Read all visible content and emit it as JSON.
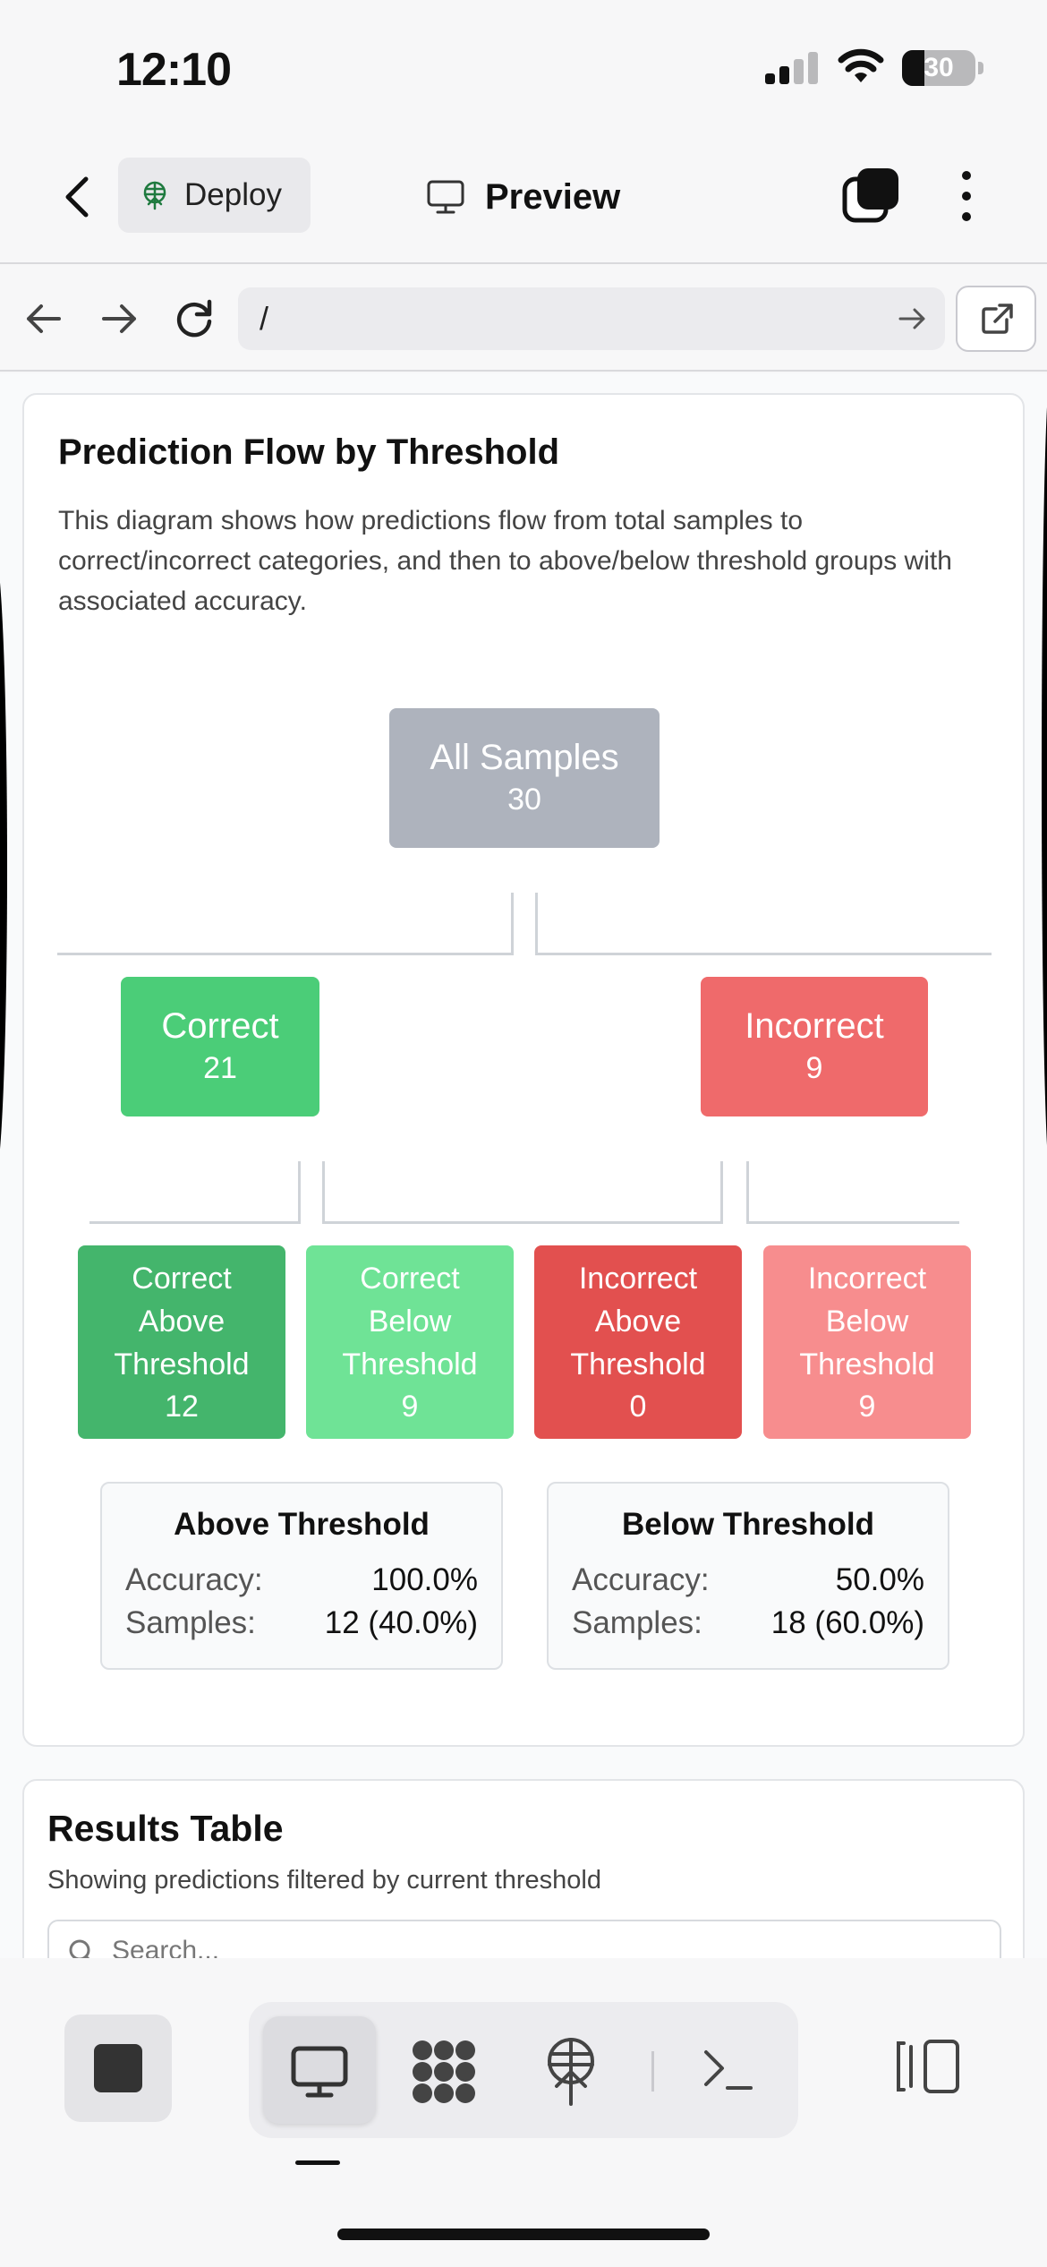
{
  "status_bar": {
    "time": "12:10",
    "battery": "30",
    "battery_level": 0.3
  },
  "header": {
    "deploy_label": "Deploy",
    "preview_label": "Preview"
  },
  "url_bar": {
    "url": "/"
  },
  "diagram_card": {
    "title": "Prediction Flow by Threshold",
    "description": "This diagram shows how predictions flow from total samples to correct/incorrect categories, and then to above/below threshold groups with associated accuracy.",
    "nodes": {
      "all": {
        "label": "All Samples",
        "count": "30",
        "color": "#aeb3bd"
      },
      "correct": {
        "label": "Correct",
        "count": "21",
        "color": "#4bcd78"
      },
      "incorrect": {
        "label": "Incorrect",
        "count": "9",
        "color": "#ef6a6b"
      },
      "correct_above": {
        "label": [
          "Correct",
          "Above",
          "Threshold"
        ],
        "count": "12",
        "color": "#44b56c"
      },
      "correct_below": {
        "label": [
          "Correct",
          "Below",
          "Threshold"
        ],
        "count": "9",
        "color": "#6fe396"
      },
      "incorrect_above": {
        "label": [
          "Incorrect",
          "Above",
          "Threshold"
        ],
        "count": "0",
        "color": "#e2504f"
      },
      "incorrect_below": {
        "label": [
          "Incorrect",
          "Below",
          "Threshold"
        ],
        "count": "9",
        "color": "#f78d8e"
      }
    },
    "stats": [
      {
        "title": "Above Threshold",
        "accuracy_label": "Accuracy:",
        "accuracy": "100.0%",
        "samples_label": "Samples:",
        "samples": "12 (40.0%)"
      },
      {
        "title": "Below Threshold",
        "accuracy_label": "Accuracy:",
        "accuracy": "50.0%",
        "samples_label": "Samples:",
        "samples": "18 (60.0%)"
      }
    ]
  },
  "results_card": {
    "title": "Results Table",
    "subtitle": "Showing predictions filtered by current threshold",
    "search_placeholder": "Search..."
  },
  "icons": [
    "back-icon",
    "deploy-icon",
    "monitor-icon",
    "tabs-icon",
    "more-icon",
    "arrow-left-icon",
    "arrow-right-icon",
    "reload-icon",
    "external-link-icon",
    "stop-icon",
    "apps-icon",
    "terminal-icon",
    "panel-icon"
  ]
}
